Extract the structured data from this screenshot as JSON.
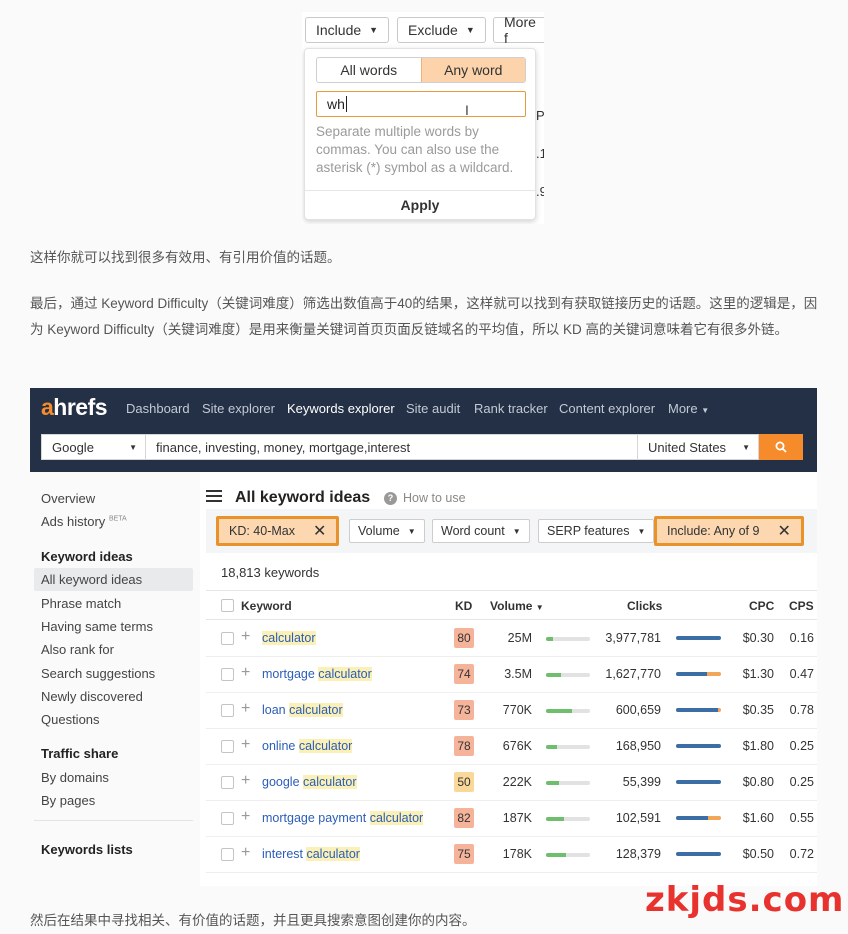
{
  "popup_crop": {
    "toolbar": {
      "include": "Include",
      "exclude": "Exclude",
      "more": "More f"
    },
    "bg_cells": [
      "P",
      ".1",
      ".9"
    ],
    "segments": {
      "all_words": "All words",
      "any_word": "Any word"
    },
    "input_value": "wh",
    "help_text": "Separate multiple words by commas. You can also use the asterisk (*) symbol as a wildcard.",
    "apply": "Apply"
  },
  "paragraphs": {
    "p1": "这样你就可以找到很多有效用、有引用价值的话题。",
    "p2": "最后，通过 Keyword Difficulty（关键词难度）筛选出数值高于40的结果，这样就可以找到有获取链接历史的话题。这里的逻辑是，因为 Keyword Difficulty（关键词难度）是用来衡量关键词首页页面反链域名的平均值，所以 KD 高的关键词意味着它有很多外链。",
    "p3": "然后在结果中寻找相关、有价值的话题，并且更具搜索意图创建你的内容。"
  },
  "ahrefs": {
    "logo_a": "a",
    "logo_rest": "hrefs",
    "nav": [
      "Dashboard",
      "Site explorer",
      "Keywords explorer",
      "Site audit",
      "Rank tracker",
      "Content explorer",
      "More"
    ],
    "search": {
      "engine": "Google",
      "query": "finance, investing, money, mortgage,interest",
      "country": "United States"
    },
    "sidebar": {
      "overview": "Overview",
      "ads_history": "Ads history",
      "beta": "BETA",
      "section_keyword_ideas": "Keyword ideas",
      "items": [
        "All keyword ideas",
        "Phrase match",
        "Having same terms",
        "Also rank for",
        "Search suggestions",
        "Newly discovered",
        "Questions"
      ],
      "section_traffic": "Traffic share",
      "traffic_items": [
        "By domains",
        "By pages"
      ],
      "keywords_lists": "Keywords lists"
    },
    "content": {
      "title": "All keyword ideas",
      "how_to": "How to use",
      "filters": {
        "kd": "KD: 40-Max",
        "volume": "Volume",
        "word_count": "Word count",
        "serp": "SERP features",
        "include": "Include: Any of 9"
      },
      "count": "18,813 keywords",
      "headers": {
        "keyword": "Keyword",
        "kd": "KD",
        "volume": "Volume",
        "clicks": "Clicks",
        "cpc": "CPC",
        "cps": "CPS"
      },
      "rows": [
        {
          "prefix": "",
          "match": "calculator",
          "kd": "80",
          "volume": "25M",
          "vol_fill": 0.15,
          "clicks": "3,977,781",
          "organic": 1.0,
          "paid": 0.0,
          "cpc": "$0.30",
          "cps": "0.16"
        },
        {
          "prefix": "mortgage ",
          "match": "calculator",
          "kd": "74",
          "volume": "3.5M",
          "vol_fill": 0.35,
          "clicks": "1,627,770",
          "organic": 0.68,
          "paid": 0.32,
          "cpc": "$1.30",
          "cps": "0.47"
        },
        {
          "prefix": "loan ",
          "match": "calculator",
          "kd": "73",
          "volume": "770K",
          "vol_fill": 0.6,
          "clicks": "600,659",
          "organic": 0.93,
          "paid": 0.07,
          "cpc": "$0.35",
          "cps": "0.78"
        },
        {
          "prefix": "online ",
          "match": "calculator",
          "kd": "78",
          "volume": "676K",
          "vol_fill": 0.25,
          "clicks": "168,950",
          "organic": 1.0,
          "paid": 0.0,
          "cpc": "$1.80",
          "cps": "0.25"
        },
        {
          "prefix": "google ",
          "match": "calculator",
          "kd": "50",
          "volume": "222K",
          "vol_fill": 0.3,
          "clicks": "55,399",
          "organic": 1.0,
          "paid": 0.0,
          "cpc": "$0.80",
          "cps": "0.25"
        },
        {
          "prefix": "mortgage payment ",
          "match": "calculator",
          "kd": "82",
          "volume": "187K",
          "vol_fill": 0.4,
          "clicks": "102,591",
          "organic": 0.7,
          "paid": 0.3,
          "cpc": "$1.60",
          "cps": "0.55"
        },
        {
          "prefix": "interest ",
          "match": "calculator",
          "kd": "75",
          "volume": "178K",
          "vol_fill": 0.45,
          "clicks": "128,379",
          "organic": 1.0,
          "paid": 0.0,
          "cpc": "$0.50",
          "cps": "0.72"
        }
      ]
    }
  },
  "watermark": "zkjds.com",
  "colors": {
    "accent": "#f58b2a",
    "nav_bg": "#243046",
    "link": "#2b5db8",
    "kd_high": "#f5b49a",
    "kd_mid": "#f9d89a"
  }
}
